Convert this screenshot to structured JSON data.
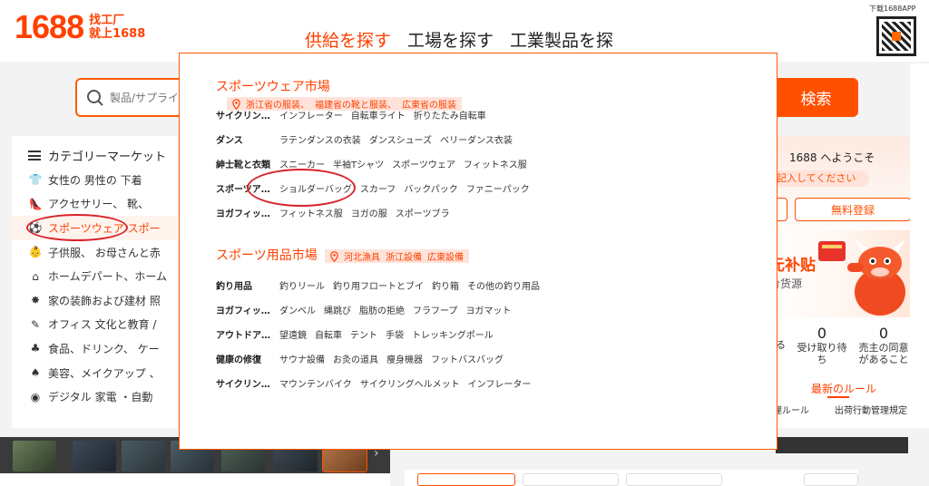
{
  "logo": {
    "number": "1688",
    "slogan_line1": "找工厂",
    "slogan_line2": "就上1688"
  },
  "top_tabs": [
    "供給を探す",
    "工場を探す",
    "工業製品を探"
  ],
  "qr": {
    "label": "下载1688APP"
  },
  "search": {
    "placeholder": "製品/サプライ",
    "button_label": "検索"
  },
  "category": {
    "header": "カテゴリーマーケット",
    "items": [
      {
        "icon": "shirt-icon",
        "glyph": "👕",
        "label": "女性の 男性の 下着"
      },
      {
        "icon": "shoe-icon",
        "glyph": "👠",
        "label": "アクセサリー、 靴、"
      },
      {
        "icon": "sports-ball-icon",
        "glyph": "⚽",
        "label": "スポーツウェア スポー"
      },
      {
        "icon": "child-clothes-icon",
        "glyph": "👶",
        "label": "子供服、 お母さんと赤"
      },
      {
        "icon": "home-icon",
        "glyph": "⌂",
        "label": "ホームデパート、ホーム"
      },
      {
        "icon": "lamp-icon",
        "glyph": "✸",
        "label": "家の装飾および建材 照"
      },
      {
        "icon": "chat-icon",
        "glyph": "✎",
        "label": "オフィス 文化と教育 /"
      },
      {
        "icon": "apple-icon",
        "glyph": "♣",
        "label": "食品、ドリンク、 ケー"
      },
      {
        "icon": "cosmetics-icon",
        "glyph": "♠",
        "label": "美容、メイクアップ 、"
      },
      {
        "icon": "camera-icon",
        "glyph": "◉",
        "label": "デジタル 家電 ・自動"
      }
    ]
  },
  "right_panel": {
    "welcome": "1688 へようこそ",
    "login_prompt": "記入してください",
    "signup_button": "無料登録",
    "promo_title": "元补贴",
    "promo_sub": "价货源",
    "stats": [
      {
        "value": "",
        "label": "る"
      },
      {
        "value": "0",
        "label": "受け取り待ち"
      },
      {
        "value": "0",
        "label": "売主の同意があること"
      }
    ],
    "rules_tab": "最新のルール",
    "rules_links": [
      "理ルール",
      "出荷行動管理規定"
    ]
  },
  "popup": {
    "sections": [
      {
        "title": "スポーツウェア市場",
        "tags": [
          "浙江省の服装、",
          "福建省の靴と服装、",
          "広東省の服装"
        ],
        "rows": [
          {
            "label": "サイクリン…",
            "items": [
              "インフレーター",
              "自転車ライト",
              "折りたたみ自転車"
            ]
          },
          {
            "label": "ダンス",
            "items": [
              "ラテンダンスの衣装",
              "ダンスシューズ",
              "ベリーダンス衣装"
            ]
          },
          {
            "label": "紳士靴と衣類",
            "items": [
              "スニーカー",
              "半袖Tシャツ",
              "スポーツウェア",
              "フィットネス服"
            ]
          },
          {
            "label": "スポーツア…",
            "items": [
              "ショルダーバッグ",
              "スカーフ",
              "バックパック",
              "ファニーパック"
            ]
          },
          {
            "label": "ヨガフィッ…",
            "items": [
              "フィットネス服",
              "ヨガの服",
              "スポーツブラ"
            ]
          }
        ]
      },
      {
        "title": "スポーツ用品市場",
        "tags": [
          "河北漁具",
          "浙江設備",
          "広東設備"
        ],
        "rows": [
          {
            "label": "釣り用品",
            "items": [
              "釣りリール",
              "釣り用フロートとブイ",
              "釣り箱",
              "その他の釣り用品"
            ]
          },
          {
            "label": "ヨガフィッ…",
            "items": [
              "ダンベル",
              "縄跳び",
              "脂肪の拒絶",
              "フラフープ",
              "ヨガマット"
            ]
          },
          {
            "label": "アウトドア…",
            "items": [
              "望遠鏡",
              "自転車",
              "テント",
              "手袋",
              "トレッキングポール"
            ]
          },
          {
            "label": "健康の修復",
            "items": [
              "サウナ設備",
              "お灸の道具",
              "痩身機器",
              "フットバスバッグ"
            ]
          },
          {
            "label": "サイクリン…",
            "items": [
              "マウンテンバイク",
              "サイクリングヘルメット",
              "インフレーター"
            ]
          }
        ]
      }
    ]
  },
  "colors": {
    "accent": "#ff4000",
    "annotation": "#d8232a"
  }
}
